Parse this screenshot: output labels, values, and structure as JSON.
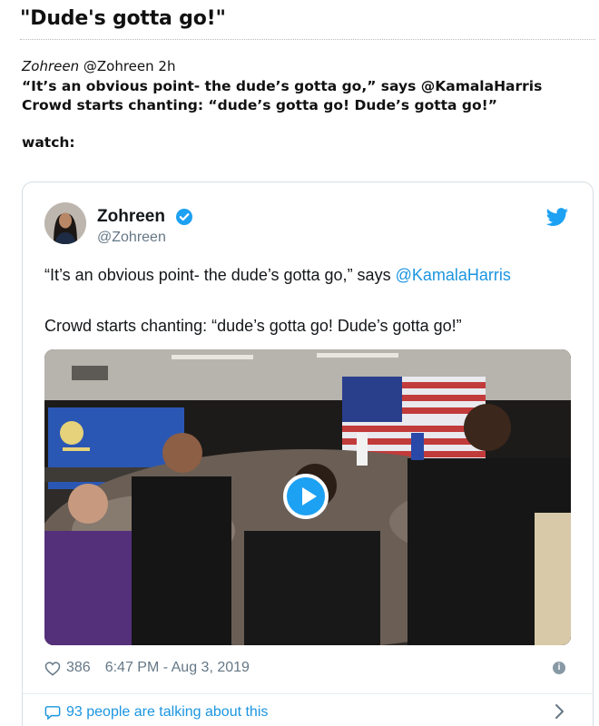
{
  "headline": "\"Dude's gotta go!\"",
  "embed_meta": {
    "author": "Zohreen",
    "handle": "@Zohreen",
    "time": "2h"
  },
  "embed_text": {
    "line1": "“It’s an obvious point- the dude’s gotta go,” says @KamalaHarris",
    "line2": "Crowd starts chanting: “dude’s gotta go! Dude’s gotta go!”",
    "watch": "watch:"
  },
  "tweet": {
    "name": "Zohreen",
    "handle": "@Zohreen",
    "text_before_mention": "“It’s an obvious point- the dude’s gotta go,” says ",
    "mention": "@KamalaHarris",
    "text_line2": "Crowd starts chanting: “dude’s gotta go! Dude’s gotta go!”",
    "likes": "386",
    "timestamp": "6:47 PM - Aug 3, 2019",
    "talk_link": "93 people are talking about this"
  },
  "colors": {
    "twitter_blue": "#1da1f2",
    "link_blue": "#1b95e0",
    "muted_gray": "#657786"
  },
  "icons": [
    "verified-badge-icon",
    "twitter-bird-icon",
    "play-icon",
    "heart-icon",
    "info-icon",
    "speech-bubble-icon",
    "chevron-right-icon"
  ]
}
